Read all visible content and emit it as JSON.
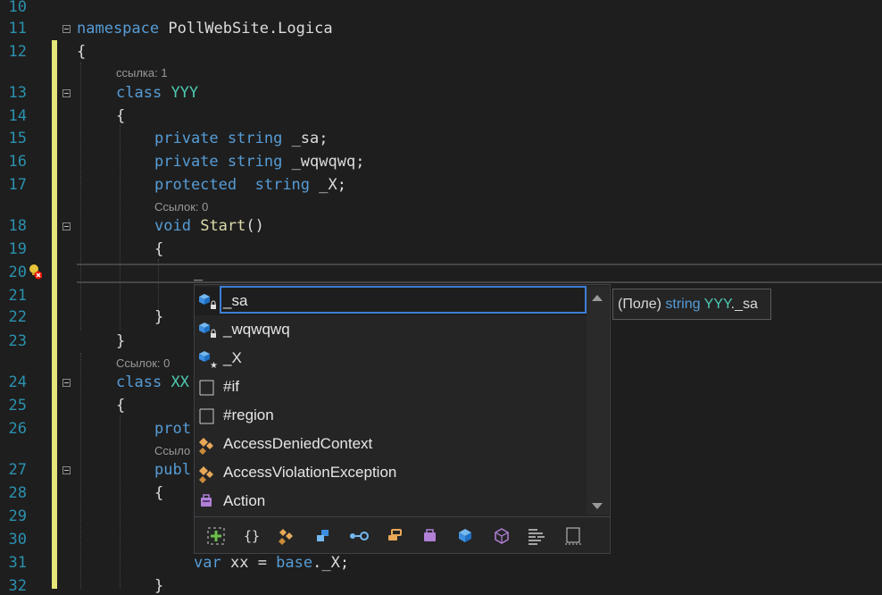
{
  "line_numbers": [
    "10",
    "11",
    "12",
    "13",
    "14",
    "15",
    "16",
    "17",
    "18",
    "19",
    "20",
    "21",
    "22",
    "23",
    "24",
    "25",
    "26",
    "27",
    "28",
    "29",
    "30",
    "31",
    "32"
  ],
  "code": {
    "l11": {
      "kw": "namespace",
      "rest": " PollWebSite.Logica"
    },
    "l12": "{",
    "l13": {
      "kw": "class",
      "name": "YYY"
    },
    "l14": "{",
    "l15": {
      "kw1": "private",
      "kw2": "string",
      "rest": " _sa;"
    },
    "l16": {
      "kw1": "private",
      "kw2": "string",
      "rest": " _wqwqwq;"
    },
    "l17": {
      "kw1": "protected",
      "kw2": "string",
      "rest": " _X;"
    },
    "l18": {
      "kw": "void",
      "name": "Start",
      "rest": "()"
    },
    "l19": "{",
    "l20": "_",
    "l22": "}",
    "l23": "}",
    "l24": {
      "kw": "class",
      "name": "XX"
    },
    "l25": "{",
    "l26": {
      "kw": "prot"
    },
    "l27": {
      "kw": "publ"
    },
    "l28": "{",
    "l31": {
      "kw": "var",
      "rest1": " ",
      "var": "xx",
      "rest2": " = ",
      "kw2": "base",
      "rest3": "._X;"
    },
    "l32": "}"
  },
  "refs": {
    "r13": "ссылка: 1",
    "r18": "Ссылок: 0",
    "r24": "Ссылок: 0",
    "r27": "Ссыло"
  },
  "completion": {
    "input_value": "_sa",
    "items": [
      {
        "label": "_sa",
        "icon": "field-private-icon"
      },
      {
        "label": "_wqwqwq",
        "icon": "field-private-icon"
      },
      {
        "label": "_X",
        "icon": "field-protected-icon"
      },
      {
        "label": "#if",
        "icon": "snippet-icon"
      },
      {
        "label": "#region",
        "icon": "snippet-icon"
      },
      {
        "label": "AccessDeniedContext",
        "icon": "class-icon"
      },
      {
        "label": "AccessViolationException",
        "icon": "class-icon"
      },
      {
        "label": "Action",
        "icon": "delegate-icon"
      }
    ],
    "filters": [
      "expand-icon",
      "namespace-icon",
      "class-icon",
      "struct-icon",
      "interface-icon",
      "enum-icon",
      "delegate-icon",
      "field-icon",
      "extension-icon",
      "keyword-icon",
      "snippet-icon"
    ]
  },
  "tooltip": {
    "prefix": "(Поле) ",
    "type": "string",
    "space": " ",
    "owner": "YYY",
    "member": "._sa"
  },
  "colors": {
    "keyword": "#569cd6",
    "type": "#4ec9b0",
    "method": "#dcdcaa",
    "line_number": "#2b91af",
    "change_bar": "#e5e57a",
    "selection_border": "#3c7fd6"
  }
}
